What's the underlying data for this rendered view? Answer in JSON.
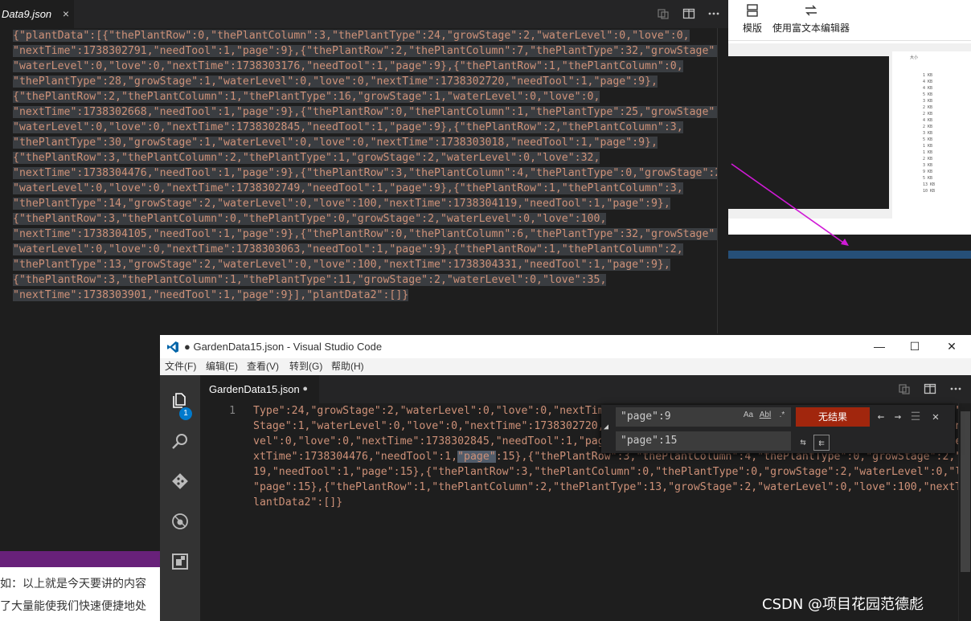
{
  "back_editor": {
    "tab_label": "Data9.json",
    "close_glyph": "×",
    "code_lines": [
      "{\"plantData\":[{\"thePlantRow\":0,\"thePlantColumn\":3,\"thePlantType\":24,\"growStage\":2,\"waterLevel\":0,\"love\":0,",
      "\"nextTime\":1738302791,\"needTool\":1,\"page\":9},{\"thePlantRow\":2,\"thePlantColumn\":7,\"thePlantType\":32,\"growStage\":1,",
      "\"waterLevel\":0,\"love\":0,\"nextTime\":1738303176,\"needTool\":1,\"page\":9},{\"thePlantRow\":1,\"thePlantColumn\":0,",
      "\"thePlantType\":28,\"growStage\":1,\"waterLevel\":0,\"love\":0,\"nextTime\":1738302720,\"needTool\":1,\"page\":9},",
      "{\"thePlantRow\":2,\"thePlantColumn\":1,\"thePlantType\":16,\"growStage\":1,\"waterLevel\":0,\"love\":0,",
      "\"nextTime\":1738302668,\"needTool\":1,\"page\":9},{\"thePlantRow\":0,\"thePlantColumn\":1,\"thePlantType\":25,\"growStage\":1,",
      "\"waterLevel\":0,\"love\":0,\"nextTime\":1738302845,\"needTool\":1,\"page\":9},{\"thePlantRow\":2,\"thePlantColumn\":3,",
      "\"thePlantType\":30,\"growStage\":1,\"waterLevel\":0,\"love\":0,\"nextTime\":1738303018,\"needTool\":1,\"page\":9},",
      "{\"thePlantRow\":3,\"thePlantColumn\":2,\"thePlantType\":1,\"growStage\":2,\"waterLevel\":0,\"love\":32,",
      "\"nextTime\":1738304476,\"needTool\":1,\"page\":9},{\"thePlantRow\":3,\"thePlantColumn\":4,\"thePlantType\":0,\"growStage\":2,",
      "\"waterLevel\":0,\"love\":0,\"nextTime\":1738302749,\"needTool\":1,\"page\":9},{\"thePlantRow\":1,\"thePlantColumn\":3,",
      "\"thePlantType\":14,\"growStage\":2,\"waterLevel\":0,\"love\":100,\"nextTime\":1738304119,\"needTool\":1,\"page\":9},",
      "{\"thePlantRow\":3,\"thePlantColumn\":0,\"thePlantType\":0,\"growStage\":2,\"waterLevel\":0,\"love\":100,",
      "\"nextTime\":1738304105,\"needTool\":1,\"page\":9},{\"thePlantRow\":0,\"thePlantColumn\":6,\"thePlantType\":32,\"growStage\":1,",
      "\"waterLevel\":0,\"love\":0,\"nextTime\":1738303063,\"needTool\":1,\"page\":9},{\"thePlantRow\":1,\"thePlantColumn\":2,",
      "\"thePlantType\":13,\"growStage\":2,\"waterLevel\":0,\"love\":100,\"nextTime\":1738304331,\"needTool\":1,\"page\":9},",
      "{\"thePlantRow\":3,\"thePlantColumn\":1,\"thePlantType\":11,\"growStage\":2,\"waterLevel\":0,\"love\":35,",
      "\"nextTime\":1738303901,\"needTool\":1,\"page\":9}],\"plantData2\":[]}"
    ]
  },
  "right_panel": {
    "ribbon": {
      "template_label": "模版",
      "rich_text_label": "使用富文本编辑器"
    },
    "mini_header": "大小",
    "mini_sizes": [
      "1 KB",
      "4 KB",
      "4 KB",
      "5 KB",
      "3 KB",
      "2 KB",
      "2 KB",
      "4 KB",
      "2 KB",
      "3 KB",
      "5 KB",
      "1 KB",
      "1 KB",
      "2 KB",
      "3 KB",
      "9 KB",
      "5 KB",
      "13 KB",
      "10 KB"
    ]
  },
  "blog": {
    "line1": "如：以上就是今天要讲的内容",
    "line2": "了大量能使我们快速便捷地处"
  },
  "window": {
    "title": "● GardenData15.json - Visual Studio Code",
    "minimize": "—",
    "maximize": "☐",
    "close": "✕",
    "menu": [
      "文件(F)",
      "编辑(E)",
      "查看(V)",
      "转到(G)",
      "帮助(H)"
    ],
    "badge": "1",
    "tab_label": "GardenData15.json",
    "tab_dirty": "●",
    "line_number": "1",
    "code_lines": [
      "Type\":24,\"growStage\":2,\"waterLevel\":0,\"love\":0,\"nextTime\":1738302791,\"needTool\":1,\"page\":15},{\"thePlantRow\":2,\"thePl",
      "Stage\":1,\"waterLevel\":0,\"love\":0,\"nextTime\":1738302720,\"needTool\":1,\"page\":15},{\"thePlantRow\":2,\"thePlantColumn\":1,\"",
      "vel\":0,\"love\":0,\"nextTime\":1738302845,\"needTool\":1,\"page\":15},{\"thePlantRow\":2,\"thePlantColumn\":3,\"thePlantType\":30,",
      "xtTime\":1738304476,\"needTool\":1,\"page\":15},{\"thePlantRow\":3,\"thePlantColumn\":4,\"thePlantType\":0,\"growStage\":2,\"water",
      "19,\"needTool\":1,\"page\":15},{\"thePlantRow\":3,\"thePlantColumn\":0,\"thePlantType\":0,\"growStage\":2,\"waterLevel\":0,\"love\"",
      "\"page\":15},{\"thePlantRow\":1,\"thePlantColumn\":2,\"thePlantType\":13,\"growStage\":2,\"waterLevel\":0,\"love\":100,\"nextTime\"",
      "lantData2\":[]}"
    ],
    "find": {
      "find_value": "\"page\":9",
      "replace_value": "\"page\":15",
      "match_case": "Aa",
      "whole_word": "Abl",
      "regex": ".*",
      "result": "无结果",
      "prev": "←",
      "next": "→",
      "selection": "☰",
      "close": "✕",
      "replace_one": "⇆",
      "replace_all": "⇇"
    }
  },
  "watermark": "CSDN @项目花园范德彪",
  "colors": {
    "editor_bg": "#1e1e1e",
    "string": "#ce9178",
    "accent": "#007acc",
    "purple": "#68217a",
    "no_result": "#a1260d"
  }
}
